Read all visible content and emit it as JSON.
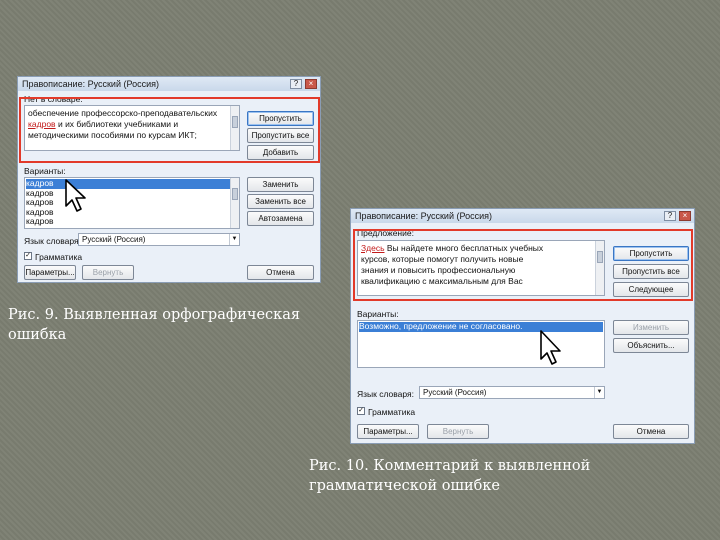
{
  "colors": {
    "background": "#7c7f72",
    "highlight_frame": "#e23a2a",
    "caption_text": "#ffffff",
    "selection": "#3b7fd6"
  },
  "dialog1": {
    "title": "Правописание: Русский (Россия)",
    "section_label": "Нет в словаре:",
    "text_lines": [
      {
        "pre": "обеспечение профессорско-преподавательских",
        "err": "",
        "post": ""
      },
      {
        "pre": "",
        "err": "кадров",
        "post": "и их библиотеки учебниками и"
      },
      {
        "pre": "методическими пособиями по курсам ИКТ;",
        "err": "",
        "post": ""
      }
    ],
    "buttons": {
      "skip": "Пропустить",
      "skip_all": "Пропустить все",
      "add": "Добавить",
      "replace": "Заменить",
      "replace_all": "Заменить все",
      "autocorrect": "Автозамена",
      "options": "Параметры...",
      "undo": "Вернуть",
      "cancel": "Отмена"
    },
    "variants_label": "Варианты:",
    "variants": [
      "кадров",
      "кадров",
      "кадров",
      "кадров",
      "кадров",
      "кадров",
      "кадров"
    ],
    "dictionary_label": "Язык словаря:",
    "dictionary_value": "Русский (Россия)",
    "grammar_label": "Грамматика",
    "grammar_checked": true
  },
  "dialog2": {
    "title": "Правописание: Русский (Россия)",
    "section_label": "Предложение:",
    "text_lines": [
      {
        "pre": "",
        "err": "Здесь",
        "post": "Вы найдете много бесплатных учебных"
      },
      {
        "pre": "курсов, которые помогут получить новые",
        "err": "",
        "post": ""
      },
      {
        "pre": "знания и повысить профессиональную",
        "err": "",
        "post": ""
      },
      {
        "pre": "квалификацию с максимальным для Вас",
        "err": "",
        "post": ""
      }
    ],
    "buttons": {
      "skip": "Пропустить",
      "skip_all": "Пропустить все",
      "next": "Следующее",
      "change": "Изменить",
      "explain": "Объяснить...",
      "options": "Параметры...",
      "undo": "Вернуть",
      "cancel": "Отмена"
    },
    "variants_label": "Варианты:",
    "variants": [
      "Возможно, предложение не согласовано."
    ],
    "dictionary_label": "Язык словаря:",
    "dictionary_value": "Русский (Россия)",
    "grammar_label": "Грамматика",
    "grammar_checked": true
  },
  "captions": {
    "fig9": [
      "Рис. 9. Выявленная орфографическая",
      "ошибка"
    ],
    "fig10": [
      "Рис. 10. Комментарий к выявленной",
      "грамматической ошибке"
    ]
  },
  "icons": {
    "cursor": "mouse-pointer-icon",
    "help": "help-icon",
    "close": "close-icon"
  }
}
